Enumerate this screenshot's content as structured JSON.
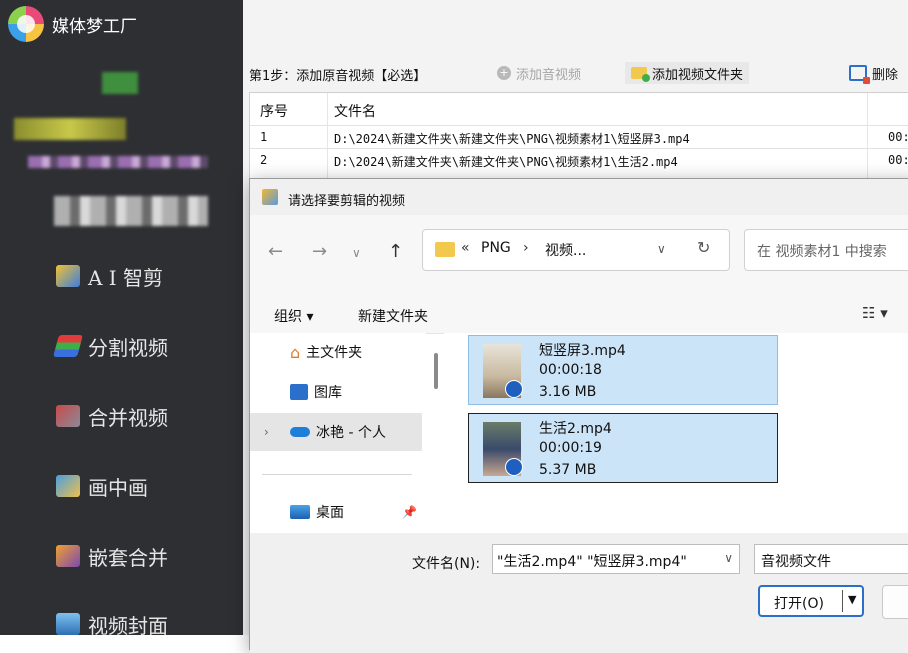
{
  "app": {
    "title": "媒体梦工厂"
  },
  "sidebar": {
    "items": [
      {
        "label": "A I 智剪",
        "icon": "ai-cut-icon"
      },
      {
        "label": "分割视频",
        "icon": "split-video-icon"
      },
      {
        "label": "合并视频",
        "icon": "merge-video-icon"
      },
      {
        "label": "画中画",
        "icon": "picture-in-picture-icon"
      },
      {
        "label": "嵌套合并",
        "icon": "nested-merge-icon"
      },
      {
        "label": "视频封面",
        "icon": "video-cover-icon"
      }
    ]
  },
  "toolbar": {
    "step1": "第1步：添加原音视频【必选】",
    "add_audio": "添加音视频",
    "add_folder": "添加视频文件夹",
    "delete": "删除"
  },
  "file_table": {
    "headers": [
      "序号",
      "文件名"
    ],
    "rows": [
      {
        "index": "1",
        "name": "D:\\2024\\新建文件夹\\新建文件夹\\PNG\\视频素材1\\短竖屏3.mp4",
        "time": "00:"
      },
      {
        "index": "2",
        "name": "D:\\2024\\新建文件夹\\新建文件夹\\PNG\\视频素材1\\生活2.mp4",
        "time": "00:"
      }
    ]
  },
  "dialog": {
    "title": "请选择要剪辑的视频",
    "address": {
      "prefix": "«",
      "crumb1": "PNG",
      "sep": "›",
      "crumb2": "视频..."
    },
    "search_placeholder": "在 视频素材1 中搜索",
    "organize": "组织 ▾",
    "new_folder": "新建文件夹",
    "nav_pane": [
      {
        "label": "主文件夹",
        "icon": "home-icon"
      },
      {
        "label": "图库",
        "icon": "gallery-icon"
      },
      {
        "label": "冰艳 - 个人",
        "icon": "onedrive-icon"
      },
      {
        "label": "桌面",
        "icon": "desktop-icon"
      }
    ],
    "files": [
      {
        "name": "短竖屏3.mp4",
        "duration": "00:00:18",
        "size": "3.16 MB"
      },
      {
        "name": "生活2.mp4",
        "duration": "00:00:19",
        "size": "5.37 MB"
      }
    ],
    "filename_label": "文件名(N):",
    "filename_value": "\"生活2.mp4\" \"短竖屏3.mp4\"",
    "filetype": "音视频文件",
    "open_button": "打开(O)"
  }
}
